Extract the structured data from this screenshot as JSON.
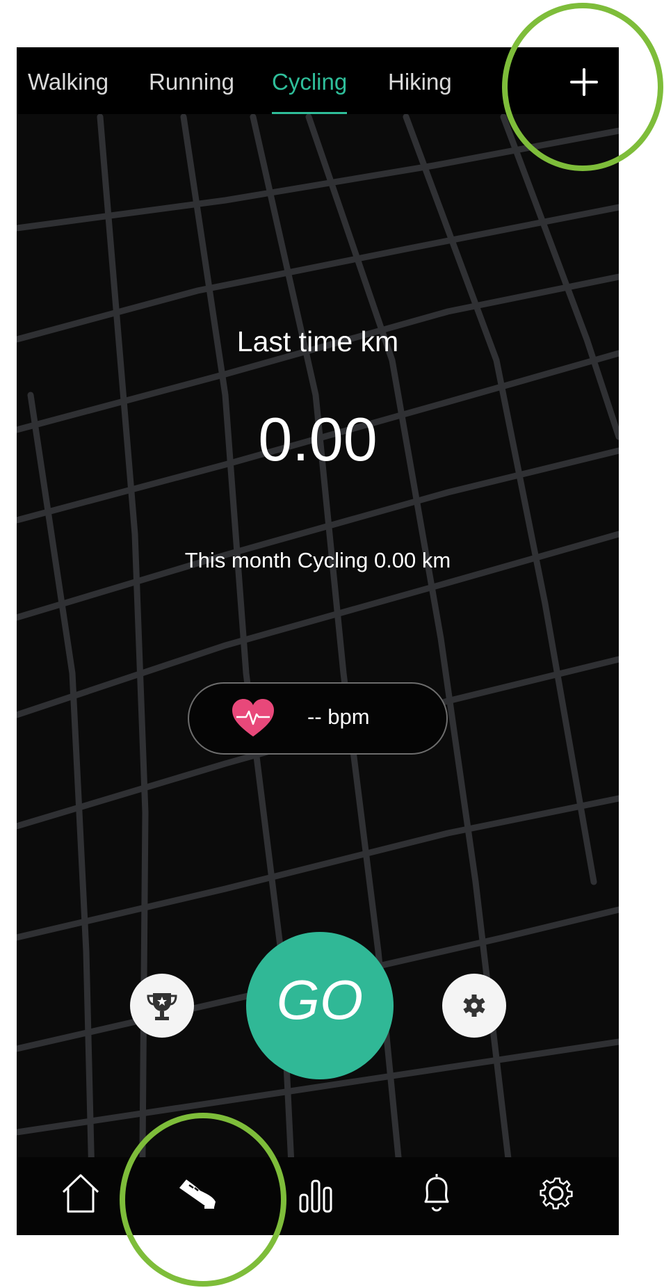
{
  "tabs": [
    {
      "label": "Walking",
      "active": false
    },
    {
      "label": "Running",
      "active": false
    },
    {
      "label": "Cycling",
      "active": true
    },
    {
      "label": "Hiking",
      "active": false
    }
  ],
  "add_tab_icon": "plus-icon",
  "stats": {
    "title": "Last time km",
    "value": "0.00",
    "month_summary": "This month Cycling 0.00 km"
  },
  "heart_rate": {
    "icon": "heart-pulse-icon",
    "text": "-- bpm"
  },
  "actions": {
    "left_icon": "trophy-icon",
    "go_label": "GO",
    "right_icon": "gear-icon"
  },
  "bottom_nav": [
    {
      "icon": "home-icon",
      "active": false
    },
    {
      "icon": "sneaker-icon",
      "active": true
    },
    {
      "icon": "bar-chart-icon",
      "active": false
    },
    {
      "icon": "bell-icon",
      "active": false
    },
    {
      "icon": "settings-icon",
      "active": false
    }
  ],
  "colors": {
    "accent": "#2fbe9a",
    "go_button": "#30b896",
    "heart": "#e8487a",
    "background": "#0b0b0b",
    "annotation_ring": "#7ebd3a"
  }
}
